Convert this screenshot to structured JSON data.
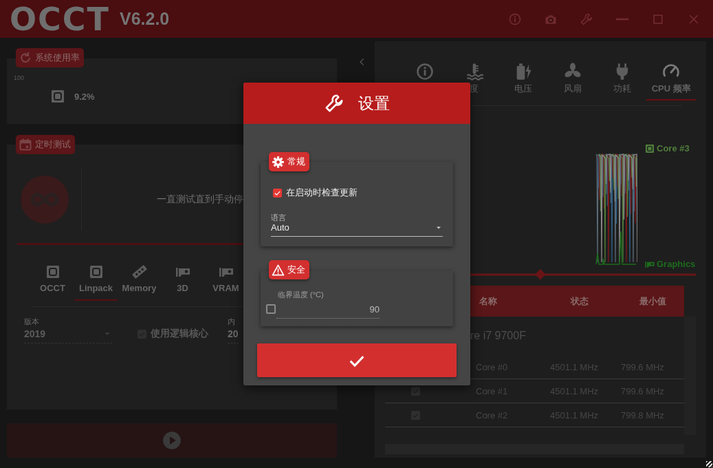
{
  "window": {
    "logo": "OCCT",
    "version": "V6.2.0",
    "controls": [
      {
        "kind": "info"
      },
      {
        "kind": "camera"
      },
      {
        "kind": "wrench"
      },
      {
        "kind": "minimize"
      },
      {
        "kind": "maximize"
      },
      {
        "kind": "close"
      }
    ]
  },
  "usage": {
    "title": "系统使用率",
    "axis_max": "100",
    "cpu_load": "9.2%"
  },
  "timed_test": {
    "title": "定时测试",
    "mode_text": "一直测试直到手动停",
    "tests": [
      {
        "kind": "cpu",
        "label": "OCCT",
        "selected": false
      },
      {
        "kind": "cpu",
        "label": "Linpack",
        "selected": true
      },
      {
        "kind": "memory",
        "label": "Memory",
        "selected": false
      },
      {
        "kind": "gpu",
        "label": "3D",
        "selected": false
      },
      {
        "kind": "gpu",
        "label": "VRAM",
        "selected": false
      }
    ],
    "version_field": {
      "label": "版本",
      "value": "2019"
    },
    "logical_cores": {
      "label": "使用逻辑核心",
      "checked": true
    },
    "memory_field": {
      "label": "内",
      "value": "20"
    }
  },
  "monitor": {
    "tabs": [
      {
        "kind": "info",
        "selected": false
      },
      {
        "kind": "temperature",
        "label": "度",
        "selected": false
      },
      {
        "kind": "voltage",
        "label": "电压",
        "selected": false
      },
      {
        "kind": "fan",
        "label": "风扇",
        "selected": false
      },
      {
        "kind": "power",
        "label": "功耗",
        "selected": false
      },
      {
        "kind": "frequency",
        "label": "CPU 频率",
        "selected": true
      }
    ],
    "legend": [
      {
        "kind": "cpu",
        "label": "Core #3",
        "color": "#4f7d3c"
      },
      {
        "kind": "gpu",
        "label": "Graphics",
        "color": "#1d6b1d"
      }
    ],
    "table": {
      "columns": [
        "名称",
        "状态",
        "最小值"
      ],
      "group": "re i7 9700F",
      "rows": [
        {
          "name": "Core #0",
          "status": "4501.1 MHz",
          "min": "799.6 MHz"
        },
        {
          "checked": true,
          "name": "Core #1",
          "status": "4501.1 MHz",
          "min": "799.6 MHz"
        },
        {
          "checked": true,
          "name": "Core #2",
          "status": "4501.1 MHz",
          "min": "799.8 MHz"
        }
      ]
    }
  },
  "settings": {
    "title": "设置",
    "general": {
      "title": "常规",
      "check_updates": {
        "label": "在启动时检查更新",
        "checked": true
      },
      "language": {
        "label": "语言",
        "value": "Auto"
      }
    },
    "safety": {
      "title": "安全",
      "critical_temp": {
        "label": "临界温度 (°C)",
        "enabled": false,
        "value": "90"
      }
    }
  }
}
